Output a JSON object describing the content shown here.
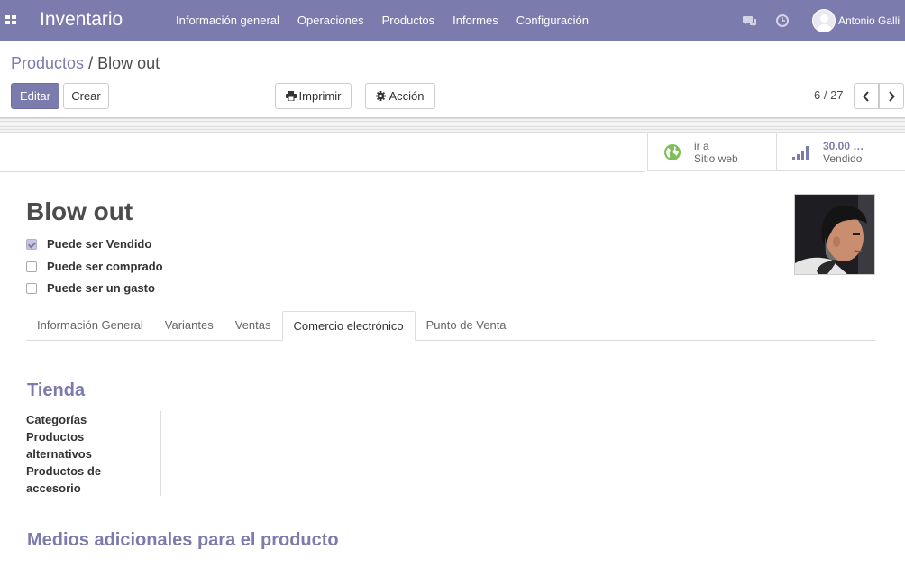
{
  "navbar": {
    "brand": "Inventario",
    "menu": [
      "Información general",
      "Operaciones",
      "Productos",
      "Informes",
      "Configuración"
    ],
    "icons": [
      "apps-icon",
      "chat-icon",
      "clock-icon"
    ],
    "user_name": "Antonio Galli"
  },
  "breadcrumb": {
    "parent": "Productos",
    "separator": "/",
    "current": "Blow out"
  },
  "toolbar": {
    "edit_label": "Editar",
    "create_label": "Crear",
    "print_label": "Imprimir",
    "action_label": "Acción"
  },
  "pager": {
    "value": "6 / 27"
  },
  "smart_buttons": {
    "website": {
      "line1": "ir a",
      "line2": "Sitio web",
      "icon": "globe-icon"
    },
    "sold": {
      "value": "30.00 …",
      "label": "Vendido",
      "icon": "signal-icon"
    }
  },
  "product": {
    "name": "Blow out",
    "checks": [
      {
        "label": "Puede ser Vendido",
        "checked": true
      },
      {
        "label": "Puede ser comprado",
        "checked": false
      },
      {
        "label": "Puede ser un gasto",
        "checked": false
      }
    ]
  },
  "tabs": [
    {
      "label": "Información General",
      "active": false
    },
    {
      "label": "Variantes",
      "active": false
    },
    {
      "label": "Ventas",
      "active": false
    },
    {
      "label": "Comercio electrónico",
      "active": true
    },
    {
      "label": "Punto de Venta",
      "active": false
    }
  ],
  "shop_section": {
    "title": "Tienda",
    "fields": [
      "Categorías",
      "Productos alternativos",
      "Productos de accesorio"
    ]
  },
  "media_section": {
    "title": "Medios adicionales para el producto"
  },
  "colors": {
    "brand": "#7c7bad",
    "globe": "#7fbf5a"
  }
}
